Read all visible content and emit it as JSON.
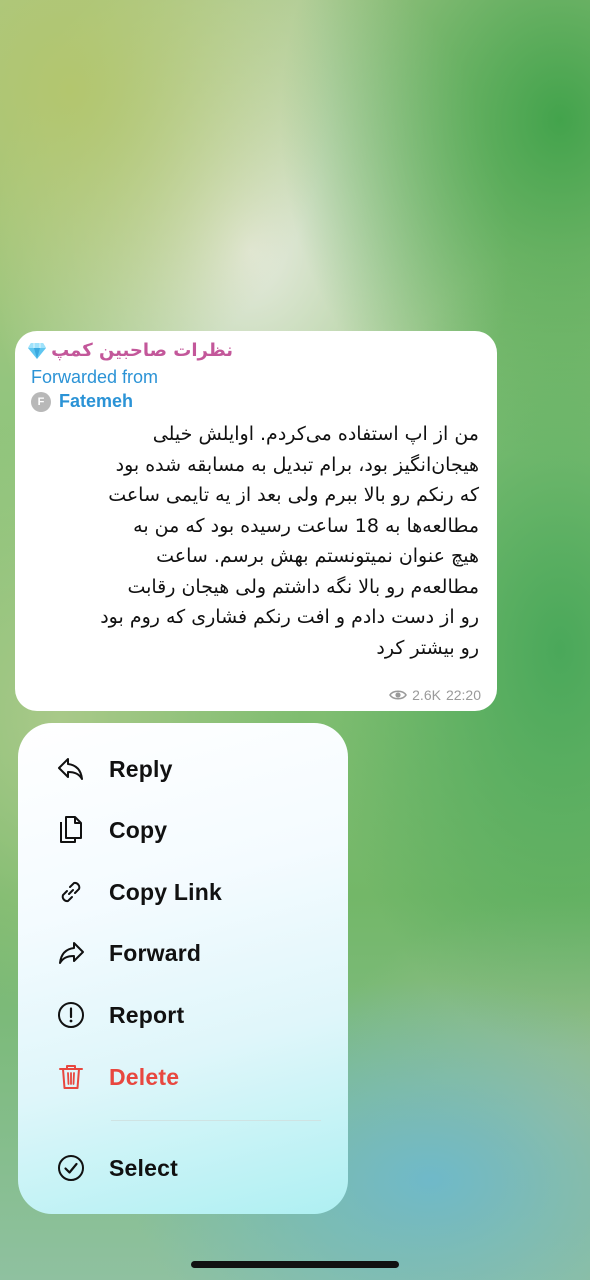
{
  "message": {
    "channel_name": "نظرات صاحبین کمپ",
    "channel_icon": "diamond-icon",
    "forwarded_label": "Forwarded from",
    "author_initial": "F",
    "author_name": "Fatemeh",
    "lines": [
      "من از اپ استفاده می‌کردم. اوایلش خیلی",
      "هیجان‌انگیز بود، برام تبدیل به مسابقه شده بود",
      "که رنکم رو بالا ببرم ولی بعد از یه تایمی ساعت",
      "مطالعه‌ها به 18 ساعت رسیده بود که من به",
      "هیچ عنوان نمیتونستم بهش برسم. ساعت",
      "مطالعه‌م رو بالا نگه داشتم ولی هیجان رقابت",
      "رو از دست دادم و افت رنکم فشاری که روم بود",
      "رو بیشتر کرد"
    ],
    "views": "2.6K",
    "time": "22:20"
  },
  "menu": {
    "items": [
      {
        "label": "Reply",
        "icon": "reply-icon"
      },
      {
        "label": "Copy",
        "icon": "copy-icon"
      },
      {
        "label": "Copy Link",
        "icon": "link-icon"
      },
      {
        "label": "Forward",
        "icon": "forward-icon"
      },
      {
        "label": "Report",
        "icon": "report-icon"
      },
      {
        "label": "Delete",
        "icon": "trash-icon"
      },
      {
        "label": "Select",
        "icon": "select-check-icon"
      }
    ]
  },
  "colors": {
    "channel_name": "#c3579a",
    "link_blue": "#2b93d6",
    "delete_red": "#e8473f"
  }
}
